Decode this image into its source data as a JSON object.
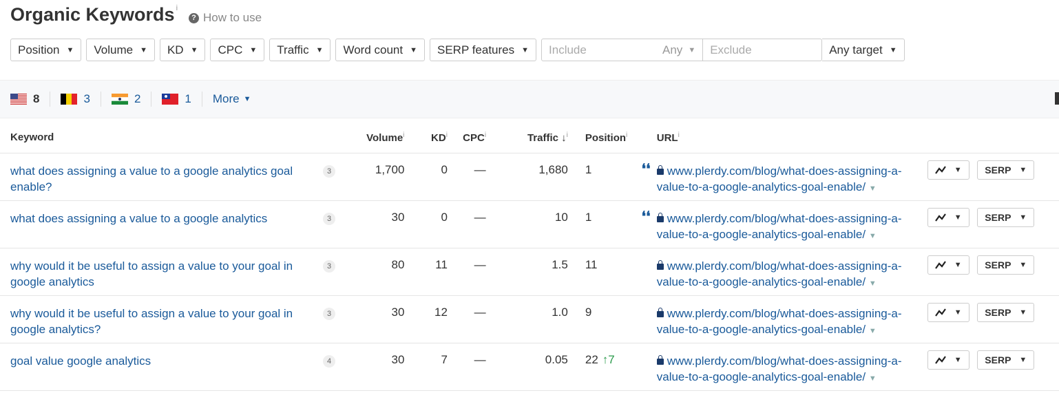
{
  "header": {
    "title": "Organic Keywords",
    "info": "i",
    "how_to_use": "How to use"
  },
  "filters": {
    "buttons": [
      "Position",
      "Volume",
      "KD",
      "CPC",
      "Traffic",
      "Word count",
      "SERP features"
    ],
    "include_placeholder": "Include",
    "include_mode": "Any",
    "exclude_placeholder": "Exclude",
    "target": "Any target"
  },
  "countries": [
    {
      "flag": "us",
      "count": "8"
    },
    {
      "flag": "be",
      "count": "3"
    },
    {
      "flag": "in",
      "count": "2"
    },
    {
      "flag": "tw",
      "count": "1"
    }
  ],
  "more_label": "More",
  "columns": {
    "keyword": "Keyword",
    "volume": "Volume",
    "kd": "KD",
    "cpc": "CPC",
    "traffic": "Traffic",
    "position": "Position",
    "url": "URL",
    "info": "i",
    "sort_arrow": "↓"
  },
  "rows": [
    {
      "keyword": "what does assigning a value to a google analytics goal enable?",
      "serp_count": "3",
      "volume": "1,700",
      "kd": "0",
      "cpc": "—",
      "traffic": "1,680",
      "position": "1",
      "change": "",
      "snippet": true,
      "url": "www.plerdy.com/blog/what-does-assigning-a-value-to-a-google-analytics-goal-enable/"
    },
    {
      "keyword": "what does assigning a value to a google analytics",
      "serp_count": "3",
      "volume": "30",
      "kd": "0",
      "cpc": "—",
      "traffic": "10",
      "position": "1",
      "change": "",
      "snippet": true,
      "url": "www.plerdy.com/blog/what-does-assigning-a-value-to-a-google-analytics-goal-enable/"
    },
    {
      "keyword": "why would it be useful to assign a value to your goal in google analytics",
      "serp_count": "3",
      "volume": "80",
      "kd": "11",
      "cpc": "—",
      "traffic": "1.5",
      "position": "11",
      "change": "",
      "snippet": false,
      "url": "www.plerdy.com/blog/what-does-assigning-a-value-to-a-google-analytics-goal-enable/"
    },
    {
      "keyword": "why would it be useful to assign a value to your goal in google analytics?",
      "serp_count": "3",
      "volume": "30",
      "kd": "12",
      "cpc": "—",
      "traffic": "1.0",
      "position": "9",
      "change": "",
      "snippet": false,
      "url": "www.plerdy.com/blog/what-does-assigning-a-value-to-a-google-analytics-goal-enable/"
    },
    {
      "keyword": "goal value google analytics",
      "serp_count": "4",
      "volume": "30",
      "kd": "7",
      "cpc": "—",
      "traffic": "0.05",
      "position": "22",
      "change": "↑7",
      "snippet": false,
      "url": "www.plerdy.com/blog/what-does-assigning-a-value-to-a-google-analytics-goal-enable/"
    }
  ],
  "actions": {
    "serp_label": "SERP",
    "chart_icon": "trend-chart-icon"
  },
  "colors": {
    "link": "#1a5a9a",
    "up": "#2a9a4a"
  }
}
